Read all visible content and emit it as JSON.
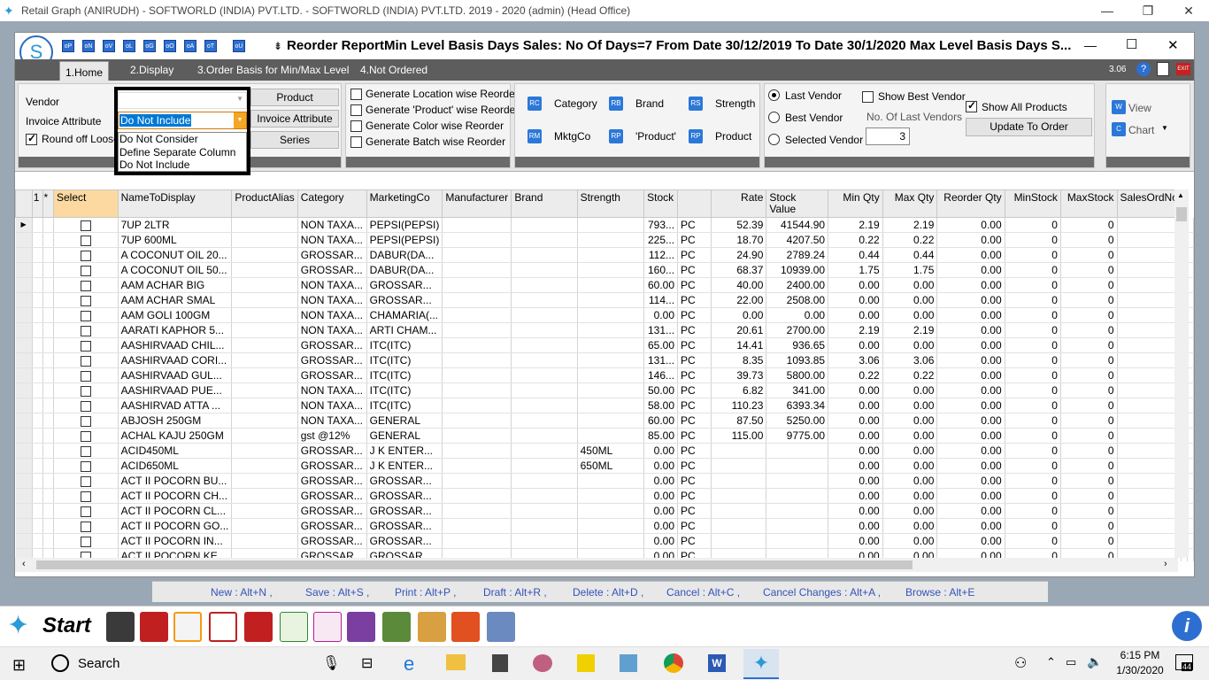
{
  "window_title": "Retail Graph (ANIRUDH) - SOFTWORLD (INDIA) PVT.LTD. - SOFTWORLD (INDIA) PVT.LTD.  2019 - 2020 (admin) (Head Office)",
  "report_title": "Reorder ReportMin Level Basis Days Sales: No Of Days=7 From Date 30/12/2019 To Date 30/1/2020 Max Level Basis Days S...",
  "quick_buttons": [
    "oP",
    "oN",
    "oV",
    "oL",
    "oG",
    "oO",
    "oA",
    "oT",
    "oU"
  ],
  "tabs": [
    "1.Home",
    "2.Display",
    "3.Order Basis for Min/Max Level",
    "4.Not Ordered"
  ],
  "version": "3.06",
  "home": {
    "vendor_label": "Vendor",
    "invoice_attr_label": "Invoice Attribute",
    "round_off_label": "Round off Loose Q",
    "invoice_attr_value": "Do Not Include",
    "dropdown_options": [
      "Do Not Consider",
      "Define Separate Column",
      "Do Not Include"
    ],
    "product_btn": "Product",
    "invoice_attr_btn": "Invoice Attribute",
    "series_btn": "Series"
  },
  "generate": [
    "Generate Location wise Reorder",
    "Generate 'Product' wise Reorder",
    "Generate Color wise Reorder",
    "Generate Batch wise Reorder"
  ],
  "filters": [
    "Category",
    "Brand",
    "Strength",
    "MktgCo",
    "'Product'",
    "Product"
  ],
  "vendor": {
    "last_vendor": "Last Vendor",
    "best_vendor": "Best Vendor",
    "selected_vendor": "Selected Vendor",
    "show_best_vendor": "Show Best Vendor",
    "no_last_vendors_label": "No. Of Last Vendors",
    "no_last_vendors_value": "3",
    "show_all_products": "Show All Products",
    "update_btn": "Update To Order"
  },
  "view_label": "View",
  "chart_label": "Chart",
  "grid": {
    "row_num": "1",
    "star": "*",
    "headers": [
      "Select",
      "NameToDisplay",
      "ProductAlias",
      "Category",
      "MarketingCo",
      "Manufacturer",
      "Brand",
      "Strength",
      "Stock",
      "",
      "Rate",
      "Stock Value",
      "Min Qty",
      "Max Qty",
      "Reorder Qty",
      "MinStock",
      "MaxStock",
      "SalesOrdNo"
    ],
    "rows": [
      [
        "7UP 2LTR",
        "",
        "NON TAXA...",
        "PEPSI(PEPSI)",
        "",
        "",
        "",
        "793...",
        "PC",
        "52.39",
        "41544.90",
        "2.19",
        "2.19",
        "0.00",
        "0",
        "0"
      ],
      [
        "7UP 600ML",
        "",
        "NON TAXA...",
        "PEPSI(PEPSI)",
        "",
        "",
        "",
        "225...",
        "PC",
        "18.70",
        "4207.50",
        "0.22",
        "0.22",
        "0.00",
        "0",
        "0"
      ],
      [
        "A COCONUT OIL 20...",
        "",
        "GROSSAR...",
        "DABUR(DA...",
        "",
        "",
        "",
        "112...",
        "PC",
        "24.90",
        "2789.24",
        "0.44",
        "0.44",
        "0.00",
        "0",
        "0"
      ],
      [
        "A COCONUT OIL 50...",
        "",
        "GROSSAR...",
        "DABUR(DA...",
        "",
        "",
        "",
        "160...",
        "PC",
        "68.37",
        "10939.00",
        "1.75",
        "1.75",
        "0.00",
        "0",
        "0"
      ],
      [
        "AAM ACHAR BIG",
        "",
        "NON TAXA...",
        "GROSSAR...",
        "",
        "",
        "",
        "60.00",
        "PC",
        "40.00",
        "2400.00",
        "0.00",
        "0.00",
        "0.00",
        "0",
        "0"
      ],
      [
        "AAM ACHAR SMAL",
        "",
        "NON TAXA...",
        "GROSSAR...",
        "",
        "",
        "",
        "114...",
        "PC",
        "22.00",
        "2508.00",
        "0.00",
        "0.00",
        "0.00",
        "0",
        "0"
      ],
      [
        "AAM GOLI 100GM",
        "",
        "NON TAXA...",
        "CHAMARIA(...",
        "",
        "",
        "",
        "0.00",
        "PC",
        "0.00",
        "0.00",
        "0.00",
        "0.00",
        "0.00",
        "0",
        "0"
      ],
      [
        "AARATI KAPHOR 5...",
        "",
        "NON TAXA...",
        "ARTI CHAM...",
        "",
        "",
        "",
        "131...",
        "PC",
        "20.61",
        "2700.00",
        "2.19",
        "2.19",
        "0.00",
        "0",
        "0"
      ],
      [
        "AASHIRVAAD CHIL...",
        "",
        "GROSSAR...",
        "ITC(ITC)",
        "",
        "",
        "",
        "65.00",
        "PC",
        "14.41",
        "936.65",
        "0.00",
        "0.00",
        "0.00",
        "0",
        "0"
      ],
      [
        "AASHIRVAAD CORI...",
        "",
        "GROSSAR...",
        "ITC(ITC)",
        "",
        "",
        "",
        "131...",
        "PC",
        "8.35",
        "1093.85",
        "3.06",
        "3.06",
        "0.00",
        "0",
        "0"
      ],
      [
        "AASHIRVAAD GUL...",
        "",
        "GROSSAR...",
        "ITC(ITC)",
        "",
        "",
        "",
        "146...",
        "PC",
        "39.73",
        "5800.00",
        "0.22",
        "0.22",
        "0.00",
        "0",
        "0"
      ],
      [
        "AASHIRVAAD PUE...",
        "",
        "NON TAXA...",
        "ITC(ITC)",
        "",
        "",
        "",
        "50.00",
        "PC",
        "6.82",
        "341.00",
        "0.00",
        "0.00",
        "0.00",
        "0",
        "0"
      ],
      [
        "AASHIRVAD ATTA ...",
        "",
        "NON TAXA...",
        "ITC(ITC)",
        "",
        "",
        "",
        "58.00",
        "PC",
        "110.23",
        "6393.34",
        "0.00",
        "0.00",
        "0.00",
        "0",
        "0"
      ],
      [
        "ABJOSH 250GM",
        "",
        "NON TAXA...",
        "GENERAL",
        "",
        "",
        "",
        "60.00",
        "PC",
        "87.50",
        "5250.00",
        "0.00",
        "0.00",
        "0.00",
        "0",
        "0"
      ],
      [
        "ACHAL KAJU 250GM",
        "",
        "gst @12%",
        "GENERAL",
        "",
        "",
        "",
        "85.00",
        "PC",
        "115.00",
        "9775.00",
        "0.00",
        "0.00",
        "0.00",
        "0",
        "0"
      ],
      [
        "ACID450ML",
        "",
        "GROSSAR...",
        "J K ENTER...",
        "",
        "",
        "450ML",
        "0.00",
        "PC",
        "",
        "",
        "0.00",
        "0.00",
        "0.00",
        "0",
        "0"
      ],
      [
        "ACID650ML",
        "",
        "GROSSAR...",
        "J K ENTER...",
        "",
        "",
        "650ML",
        "0.00",
        "PC",
        "",
        "",
        "0.00",
        "0.00",
        "0.00",
        "0",
        "0"
      ],
      [
        "ACT II POCORN BU...",
        "",
        "GROSSAR...",
        "GROSSAR...",
        "",
        "",
        "",
        "0.00",
        "PC",
        "",
        "",
        "0.00",
        "0.00",
        "0.00",
        "0",
        "0"
      ],
      [
        "ACT II POCORN CH...",
        "",
        "GROSSAR...",
        "GROSSAR...",
        "",
        "",
        "",
        "0.00",
        "PC",
        "",
        "",
        "0.00",
        "0.00",
        "0.00",
        "0",
        "0"
      ],
      [
        "ACT II POCORN CL...",
        "",
        "GROSSAR...",
        "GROSSAR...",
        "",
        "",
        "",
        "0.00",
        "PC",
        "",
        "",
        "0.00",
        "0.00",
        "0.00",
        "0",
        "0"
      ],
      [
        "ACT II POCORN GO...",
        "",
        "GROSSAR...",
        "GROSSAR...",
        "",
        "",
        "",
        "0.00",
        "PC",
        "",
        "",
        "0.00",
        "0.00",
        "0.00",
        "0",
        "0"
      ],
      [
        "ACT II POCORN IN...",
        "",
        "GROSSAR...",
        "GROSSAR...",
        "",
        "",
        "",
        "0.00",
        "PC",
        "",
        "",
        "0.00",
        "0.00",
        "0.00",
        "0",
        "0"
      ],
      [
        "ACT II POCORN KE...",
        "",
        "GROSSAR...",
        "GROSSAR...",
        "",
        "",
        "",
        "0.00",
        "PC",
        "",
        "",
        "0.00",
        "0.00",
        "0.00",
        "0",
        "0"
      ]
    ]
  },
  "shortcuts": [
    "New : Alt+N ,",
    "Save : Alt+S ,",
    "Print : Alt+P ,",
    "Draft : Alt+R ,",
    "Delete : Alt+D ,",
    "Cancel : Alt+C ,",
    "Cancel Changes : Alt+A ,",
    "Browse : Alt+E"
  ],
  "start_label": "Start",
  "search_label": "Search",
  "clock_time": "6:15 PM",
  "clock_date": "1/30/2020",
  "notif_count": "44",
  "colors": {
    "accent": "#2d6fd0",
    "tab_bar": "#5d5d5d",
    "dropdown_selected": "#0078d7",
    "shortcut_text": "#3453b8"
  }
}
